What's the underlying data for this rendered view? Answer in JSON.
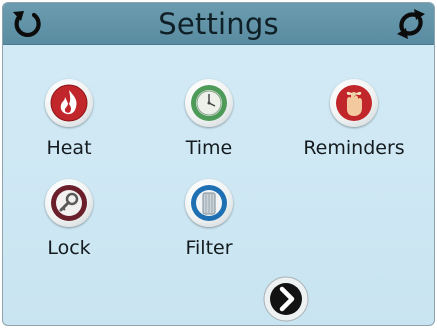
{
  "header": {
    "title": "Settings",
    "back_icon": "rotate-back-icon",
    "sync_icon": "sync-icon"
  },
  "menu": {
    "items": [
      {
        "label": "Heat",
        "icon": "flame-icon",
        "color": "#c0262a"
      },
      {
        "label": "Time",
        "icon": "clock-icon",
        "color": "#3f8a4a"
      },
      {
        "label": "Reminders",
        "icon": "string-finger-icon",
        "color": "#c0262a"
      },
      {
        "label": "Lock",
        "icon": "key-icon",
        "color": "#6a1f2a"
      },
      {
        "label": "Filter",
        "icon": "filter-cartridge-icon",
        "color": "#1f6fb3"
      }
    ]
  },
  "navigation": {
    "next_icon": "chevron-right-icon"
  },
  "colors": {
    "header": "#5f90a5",
    "background": "#cfe8f4",
    "text": "#141b1f"
  }
}
